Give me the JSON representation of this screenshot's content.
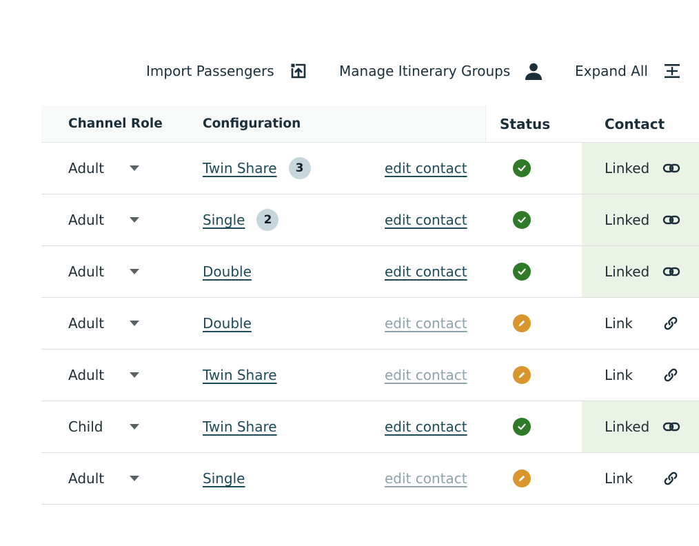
{
  "toolbar": {
    "import_label": "Import Passengers",
    "manage_label": "Manage Itinerary Groups",
    "expand_label": "Expand All"
  },
  "table": {
    "headers": {
      "role": "Channel Role",
      "configuration": "Configuration",
      "status": "Status",
      "contact": "Contact"
    },
    "rows": [
      {
        "role": "Adult",
        "config": "Twin Share",
        "badge": "3",
        "edit": "edit contact",
        "edit_state": "active",
        "status": "complete",
        "contact": "Linked"
      },
      {
        "role": "Adult",
        "config": "Single",
        "badge": "2",
        "edit": "edit contact",
        "edit_state": "active",
        "status": "complete",
        "contact": "Linked"
      },
      {
        "role": "Adult",
        "config": "Double",
        "badge": "",
        "edit": "edit contact",
        "edit_state": "active",
        "status": "complete",
        "contact": "Linked"
      },
      {
        "role": "Adult",
        "config": "Double",
        "badge": "",
        "edit": "edit contact",
        "edit_state": "muted",
        "status": "draft",
        "contact": "Link"
      },
      {
        "role": "Adult",
        "config": "Twin Share",
        "badge": "",
        "edit": "edit contact",
        "edit_state": "muted",
        "status": "draft",
        "contact": "Link"
      },
      {
        "role": "Child",
        "config": "Twin Share",
        "badge": "",
        "edit": "edit contact",
        "edit_state": "active",
        "status": "complete",
        "contact": "Linked"
      },
      {
        "role": "Adult",
        "config": "Single",
        "badge": "",
        "edit": "edit contact",
        "edit_state": "muted",
        "status": "draft",
        "contact": "Link"
      }
    ]
  },
  "colors": {
    "status_complete": "#2f7a28",
    "status_draft": "#d9952e",
    "linked_background": "#eaf3e6",
    "link_text": "#1d4a57",
    "muted_link_text": "#8fa3ab",
    "badge_background": "#c6d7dc"
  },
  "icons": {
    "import": "import-upload-icon",
    "manage": "person-icon",
    "expand": "expand-all-icon",
    "status_complete": "check-circle-icon",
    "status_draft": "pencil-circle-icon",
    "linked": "linked-chain-icon",
    "link": "link-chain-icon",
    "role_dropdown": "caret-down-icon"
  }
}
